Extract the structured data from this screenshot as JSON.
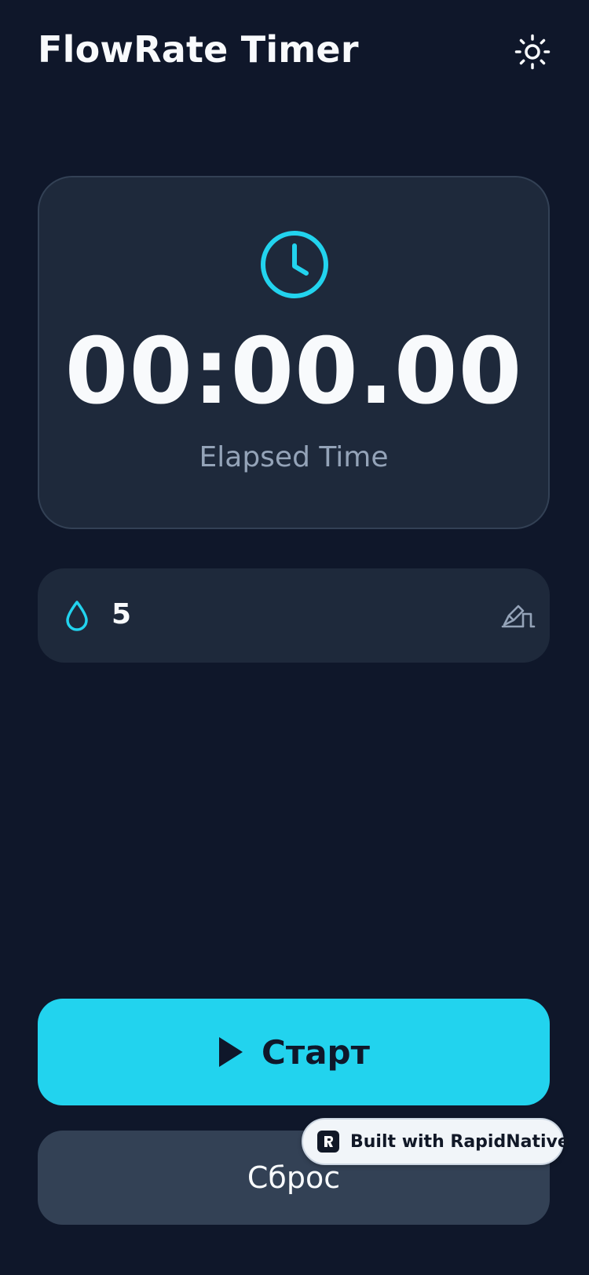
{
  "header": {
    "title": "FlowRate Timer",
    "theme_icon": "sun-icon"
  },
  "timer": {
    "icon": "clock-icon",
    "display": "00:00.00",
    "caption": "Elapsed Time"
  },
  "drops": {
    "icon": "water-drop-icon",
    "count": "5",
    "edit_icon": "pencil-ruler-icon"
  },
  "controls": {
    "start_label": "Старт",
    "start_icon": "play-icon",
    "reset_label": "Сброс"
  },
  "badge": {
    "label": "Built with RapidNative",
    "icon": "rapidnative-logo-icon"
  },
  "colors": {
    "background": "#0f172a",
    "card": "#1e293b",
    "accent": "#22d3ee",
    "secondary_button": "#334155",
    "muted_text": "#94a3b8"
  }
}
